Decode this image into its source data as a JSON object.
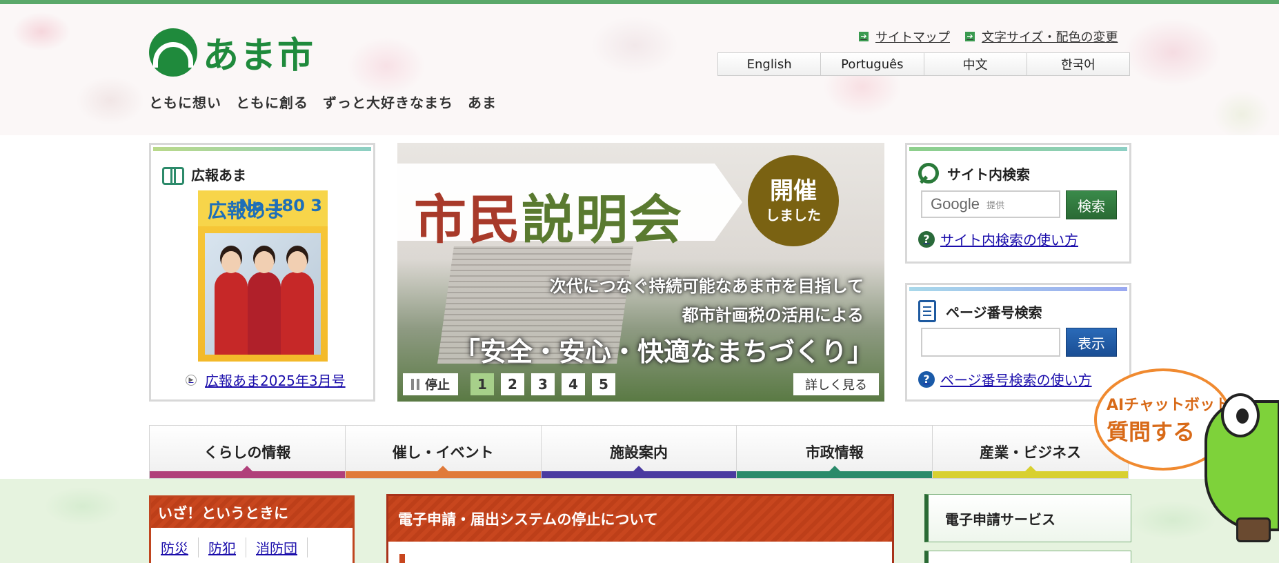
{
  "header": {
    "logo_text": "あま市",
    "slogan": "ともに想い　ともに創る　ずっと大好きなまち　あま",
    "util_links": [
      "サイトマップ",
      "文字サイズ・配色の変更"
    ],
    "languages": [
      "English",
      "Português",
      "中文",
      "한국어"
    ]
  },
  "kouhou": {
    "title": "広報あま",
    "cover_brand": "広報あま",
    "cover_num": "No.180 3",
    "link": "広報あま2025年3月号"
  },
  "slider": {
    "title_red": "市民",
    "title_green": "説明会",
    "badge_line1": "開催",
    "badge_line2": "しました",
    "sub1": "次代につなぐ持続可能なあま市を目指して",
    "sub2": "都市計画税の活用による",
    "sub3": "「安全・安心・快適なまちづくり」",
    "stop": "停止",
    "pages": [
      "1",
      "2",
      "3",
      "4",
      "5"
    ],
    "active_page": 1,
    "more": "詳しく見る"
  },
  "site_search": {
    "title": "サイト内検索",
    "google_label": "Google",
    "google_sub": "提供",
    "button": "検索",
    "help": "サイト内検索の使い方"
  },
  "page_search": {
    "title": "ページ番号検索",
    "button": "表示",
    "help": "ページ番号検索の使い方"
  },
  "nav": [
    {
      "label": "くらしの情報",
      "color": "#b0407a"
    },
    {
      "label": "催し・イベント",
      "color": "#e07a3a"
    },
    {
      "label": "施設案内",
      "color": "#4a3aa0"
    },
    {
      "label": "市政情報",
      "color": "#2a8a6a"
    },
    {
      "label": "産業・ビジネス",
      "color": "#d8d030"
    }
  ],
  "emergency": {
    "title": "いざ！というときに",
    "links": [
      "防災",
      "防犯",
      "消防団"
    ]
  },
  "notice": {
    "title": "電子申請・届出システムの停止について"
  },
  "eservice": {
    "label": "電子申請サービス"
  },
  "chatbot": {
    "line1": "AIチャットボットに",
    "line2": "質問する"
  }
}
